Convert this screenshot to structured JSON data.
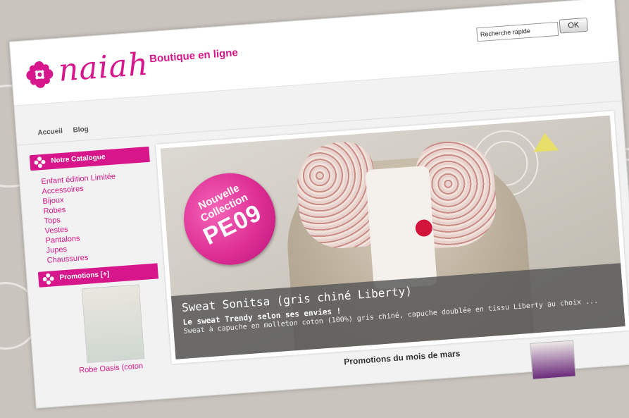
{
  "header": {
    "logo_text": "naiah",
    "tagline": "Boutique en ligne",
    "search_placeholder": "Recherche rapide",
    "ok_label": "OK"
  },
  "nav": {
    "items": [
      "Accueil",
      "Blog"
    ]
  },
  "sidebar": {
    "catalog_title": "Notre Catalogue",
    "categories": [
      "Enfant édition Limitée",
      "Accessoires",
      "Bijoux",
      "Robes",
      "Tops",
      "Vestes",
      "Pantalons",
      "Jupes",
      "Chaussures"
    ],
    "promotions_title": "Promotions [+]",
    "promo_caption": "Robe Oasis (coton"
  },
  "banner": {
    "sticker_line1": "Nouvelle",
    "sticker_line2": "Collection",
    "sticker_code": "PE09",
    "title": "Sweat Sonitsa (gris chiné Liberty)",
    "subtitle": "Le sweat Trendy selon ses envies !",
    "description": "Sweat à capuche en molleton coton (100%) gris chiné, capuche doublée en tissu Liberty au choix ..."
  },
  "main": {
    "promotions_heading": "Promotions du mois de mars"
  },
  "colors": {
    "brand_pink": "#d6168a",
    "caption_bg": "#555555"
  },
  "icons": [
    "flower-logo-icon",
    "mini-flower-icon"
  ]
}
